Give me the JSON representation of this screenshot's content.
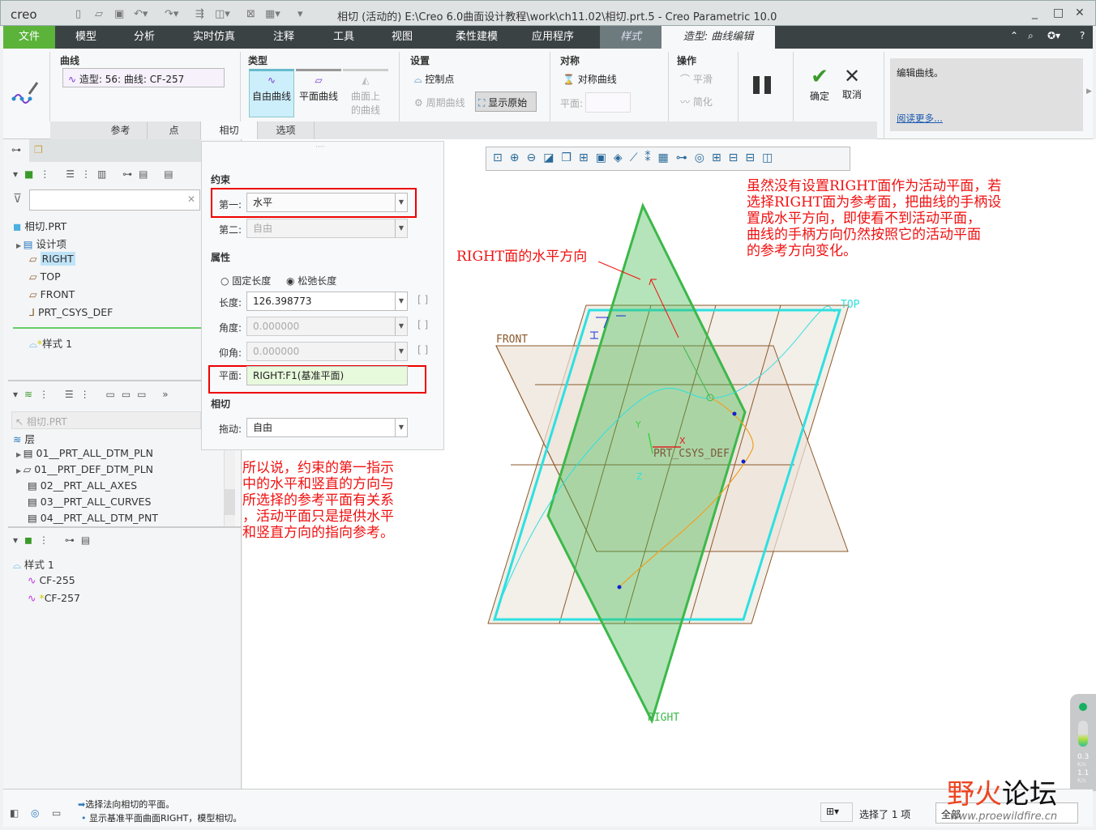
{
  "window": {
    "app_logo": "creo",
    "title": "相切 (活动的) E:\\Creo 6.0曲面设计教程\\work\\ch11.02\\相切.prt.5 - Creo Parametric 10.0"
  },
  "menu": {
    "items": [
      "文件",
      "模型",
      "分析",
      "实时仿真",
      "注释",
      "工具",
      "视图",
      "柔性建模",
      "应用程序",
      "样式",
      "造型: 曲线编辑"
    ],
    "active": "造型: 曲线编辑",
    "accent": "#5bb33a"
  },
  "ribbon": {
    "curve_group": {
      "title": "曲线",
      "value": "造型: 56: 曲线: CF-257"
    },
    "type_group": {
      "title": "类型",
      "free": "自由曲线",
      "planar": "平面曲线",
      "on_surface": "曲面上的曲线"
    },
    "settings_group": {
      "title": "设置",
      "control_points": "控制点",
      "periodic": "周期曲线",
      "show_original": "显示原始"
    },
    "symmetry_group": {
      "title": "对称",
      "symmetric_curve": "对称曲线",
      "plane_label": "平面:"
    },
    "ops_group": {
      "title": "操作",
      "smooth": "平滑",
      "simplify": "简化"
    },
    "ok": "确定",
    "cancel": "取消",
    "help": {
      "text": "编辑曲线。",
      "link": "阅读更多..."
    }
  },
  "subtabs": [
    "参考",
    "点",
    "相切",
    "选项"
  ],
  "subtabs_active": "相切",
  "model_tree": {
    "items": [
      "相切.PRT",
      "设计项",
      "RIGHT",
      "TOP",
      "FRONT",
      "PRT_CSYS_DEF",
      "样式 1"
    ],
    "selected": "RIGHT"
  },
  "layers": {
    "path": "相切.PRT",
    "root": "层",
    "items": [
      "01__PRT_ALL_DTM_PLN",
      "01__PRT_DEF_DTM_PLN",
      "02__PRT_ALL_AXES",
      "03__PRT_ALL_CURVES",
      "04__PRT_ALL_DTM_PNT"
    ]
  },
  "style_tree": {
    "root": "样式 1",
    "items": [
      "CF-255",
      "CF-257"
    ]
  },
  "tangent_panel": {
    "constraint_title": "约束",
    "first_label": "第一:",
    "first_value": "水平",
    "second_label": "第二:",
    "second_value": "自由",
    "props_title": "属性",
    "fixed_length": "固定长度",
    "relaxed_length": "松弛长度",
    "length_label": "长度:",
    "length_value": "126.398773",
    "angle_label": "角度:",
    "angle_value": "0.000000",
    "elevation_label": "仰角:",
    "elevation_value": "0.000000",
    "plane_label": "平面:",
    "plane_value": "RIGHT:F1(基准平面)",
    "tangent_title": "相切",
    "drag_label": "拖动:",
    "drag_value": "自由"
  },
  "viewport": {
    "labels": {
      "top": "TOP",
      "front": "FRONT",
      "right": "RIGHT",
      "csys": "PRT_CSYS_DEF",
      "x": "X",
      "y": "Y",
      "z": "Z"
    },
    "annotations": {
      "a1": "RIGHT面的水平方向",
      "a2": [
        "虽然没有设置RIGHT面作为活动平面，若",
        "选择RIGHT面为参考面，把曲线的手柄设",
        "置成水平方向，即使看不到活动平面，",
        "曲线的手柄方向仍然按照它的活动平面",
        "的参考方向变化。"
      ],
      "a3": [
        "所以说，约束的第一指示",
        "中的水平和竖直的方向与",
        "所选择的参考平面有关系",
        "，活动平面只是提供水平",
        "和竖直方向的指向参考。"
      ]
    },
    "colors": {
      "right_plane": "#3cb84a",
      "top_plane_edge": "#2de0e0",
      "datum": "#8b5a2b",
      "annotation": "#f01010"
    },
    "perf": {
      "v1": "0.3",
      "u1": "K/s",
      "v2": "1.1",
      "u2": "K/s"
    }
  },
  "status": {
    "msg1": "选择法向相切的平面。",
    "msg2": "显示基准平面曲面RIGHT，模型相切。",
    "selected": "选择了 1 项",
    "filter": "全部"
  },
  "watermark": {
    "text": "野火论坛",
    "url": "www.proewildfire.cn"
  }
}
